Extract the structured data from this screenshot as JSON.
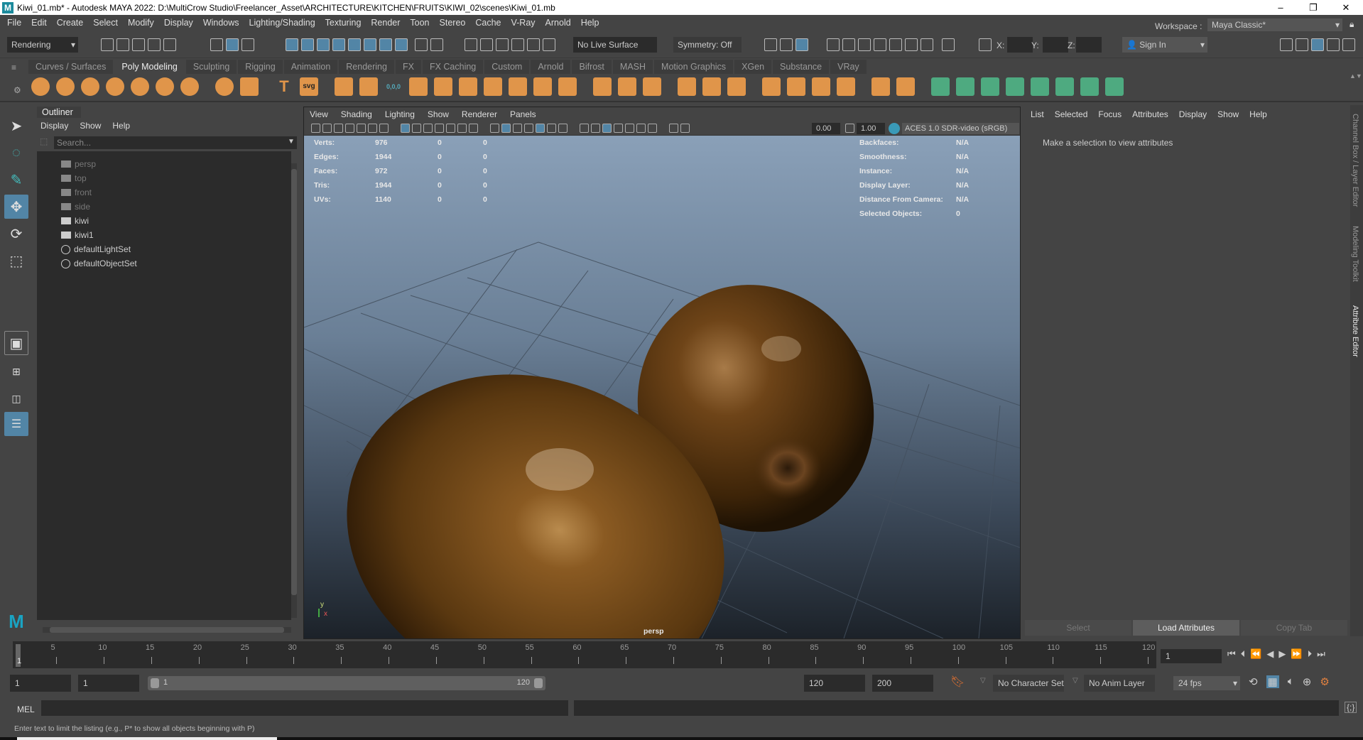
{
  "window": {
    "title": "Kiwi_01.mb* - Autodesk MAYA 2022: D:\\MultiCrow Studio\\Freelancer_Asset\\ARCHITECTURE\\KITCHEN\\FRUITS\\KIWI_02\\scenes\\Kiwi_01.mb",
    "logo": "M",
    "minimize": "–",
    "maximize": "❐",
    "close": "✕"
  },
  "menubar": [
    "File",
    "Edit",
    "Create",
    "Select",
    "Modify",
    "Display",
    "Windows",
    "Lighting/Shading",
    "Texturing",
    "Render",
    "Toon",
    "Stereo",
    "Cache",
    "V-Ray",
    "Arnold",
    "Help"
  ],
  "statusline": {
    "menuset": "Rendering",
    "live_surface": "No Live Surface",
    "symmetry": "Symmetry: Off",
    "x_label": "X:",
    "y_label": "Y:",
    "z_label": "Z:",
    "sign_in": "Sign In",
    "workspace_label": "Workspace :",
    "workspace": "Maya Classic*"
  },
  "shelf": {
    "tabs": [
      "Curves / Surfaces",
      "Poly Modeling",
      "Sculpting",
      "Rigging",
      "Animation",
      "Rendering",
      "FX",
      "FX Caching",
      "Custom",
      "Arnold",
      "Bifrost",
      "MASH",
      "Motion Graphics",
      "XGen",
      "Substance",
      "VRay"
    ],
    "active": 1,
    "svg_label": "svg",
    "text_label": "T",
    "coord_label": "0,0,0"
  },
  "outliner": {
    "title": "Outliner",
    "menu": [
      "Display",
      "Show",
      "Help"
    ],
    "search_placeholder": "Search...",
    "items": [
      {
        "label": "persp",
        "icon": "camera-icon",
        "dim": true
      },
      {
        "label": "top",
        "icon": "camera-icon",
        "dim": true
      },
      {
        "label": "front",
        "icon": "camera-icon",
        "dim": true
      },
      {
        "label": "side",
        "icon": "camera-icon",
        "dim": true
      },
      {
        "label": "kiwi",
        "icon": "mesh-transform-icon",
        "dim": false
      },
      {
        "label": "kiwi1",
        "icon": "mesh-transform-icon",
        "dim": false
      },
      {
        "label": "defaultLightSet",
        "icon": "set-icon",
        "dim": false
      },
      {
        "label": "defaultObjectSet",
        "icon": "set-icon",
        "dim": false
      }
    ]
  },
  "viewport": {
    "menu": [
      "View",
      "Shading",
      "Lighting",
      "Show",
      "Renderer",
      "Panels"
    ],
    "exposure": "0.00",
    "gamma": "1.00",
    "color_space": "ACES 1.0 SDR-video (sRGB)",
    "camera": "persp",
    "hud_left": [
      [
        "Verts:",
        "976",
        "0",
        "0"
      ],
      [
        "Edges:",
        "1944",
        "0",
        "0"
      ],
      [
        "Faces:",
        "972",
        "0",
        "0"
      ],
      [
        "Tris:",
        "1944",
        "0",
        "0"
      ],
      [
        "UVs:",
        "1140",
        "0",
        "0"
      ]
    ],
    "hud_right": [
      [
        "Backfaces:",
        "N/A"
      ],
      [
        "Smoothness:",
        "N/A"
      ],
      [
        "Instance:",
        "N/A"
      ],
      [
        "Display Layer:",
        "N/A"
      ],
      [
        "Distance From Camera:",
        "N/A"
      ],
      [
        "Selected Objects:",
        "0"
      ]
    ],
    "axis_y": "y",
    "axis_x": "x"
  },
  "attribute_editor": {
    "menu": [
      "List",
      "Selected",
      "Focus",
      "Attributes",
      "Display",
      "Show",
      "Help"
    ],
    "message": "Make a selection to view attributes",
    "buttons": [
      "Select",
      "Load Attributes",
      "Copy Tab"
    ]
  },
  "side_tabs": [
    "Channel Box / Layer Editor",
    "Modeling Toolkit",
    "Attribute Editor"
  ],
  "timeline": {
    "start": 1,
    "end": 120,
    "current": "1",
    "current_field": "1",
    "labels": [
      5,
      10,
      15,
      20,
      25,
      30,
      35,
      40,
      45,
      50,
      55,
      60,
      65,
      70,
      75,
      80,
      85,
      90,
      95,
      100,
      105,
      110,
      115,
      120
    ]
  },
  "range": {
    "start": "1",
    "anim_start": "1",
    "slider_start": "1",
    "slider_end": "120",
    "anim_end": "120",
    "end": "200",
    "character_set": "No Character Set",
    "anim_layer": "No Anim Layer",
    "fps": "24 fps"
  },
  "command": {
    "label": "MEL"
  },
  "helpline": "Enter text to limit the listing (e.g., P* to show all objects beginning with P)",
  "colors": {
    "accent": "#5285a6",
    "shelf_orange": "#e0954a",
    "shelf_green": "#4eaa80"
  }
}
